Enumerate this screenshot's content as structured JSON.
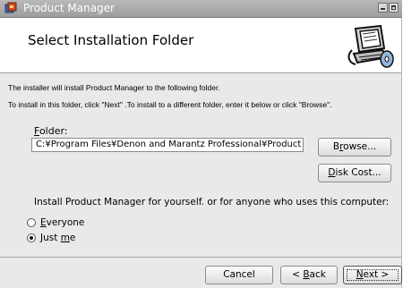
{
  "window": {
    "title": "Product Manager",
    "app_icon": "installer-app-icon",
    "controls": [
      "minimize-icon",
      "maximize-icon"
    ]
  },
  "header": {
    "title": "Select Installation Folder",
    "icon": "computer-disk-icon"
  },
  "body": {
    "line1": "The installer will install Product Manager to the following folder.",
    "line2": "To install in this folder, click \"Next\" .To install to a different folder, enter it below or click \"Browse\"."
  },
  "folder": {
    "label_accel": "F",
    "label_rest": "older:",
    "value": "C:¥Program Files¥Denon and Marantz Professional¥Product Manager¥"
  },
  "buttons": {
    "browse_pre": "B",
    "browse_accel": "r",
    "browse_post": "owse...",
    "diskcost_accel": "D",
    "diskcost_post": "isk Cost...",
    "cancel": "Cancel",
    "back_pre": "< ",
    "back_accel": "B",
    "back_post": "ack",
    "next_accel": "N",
    "next_post": "ext >"
  },
  "install_for": {
    "prompt": "Install Product Manager for yourself. or for anyone who uses this computer:",
    "options": [
      {
        "accel": "E",
        "rest": "veryone",
        "selected": false
      },
      {
        "pre": "Just ",
        "accel": "m",
        "rest": "e",
        "selected": true
      }
    ]
  }
}
